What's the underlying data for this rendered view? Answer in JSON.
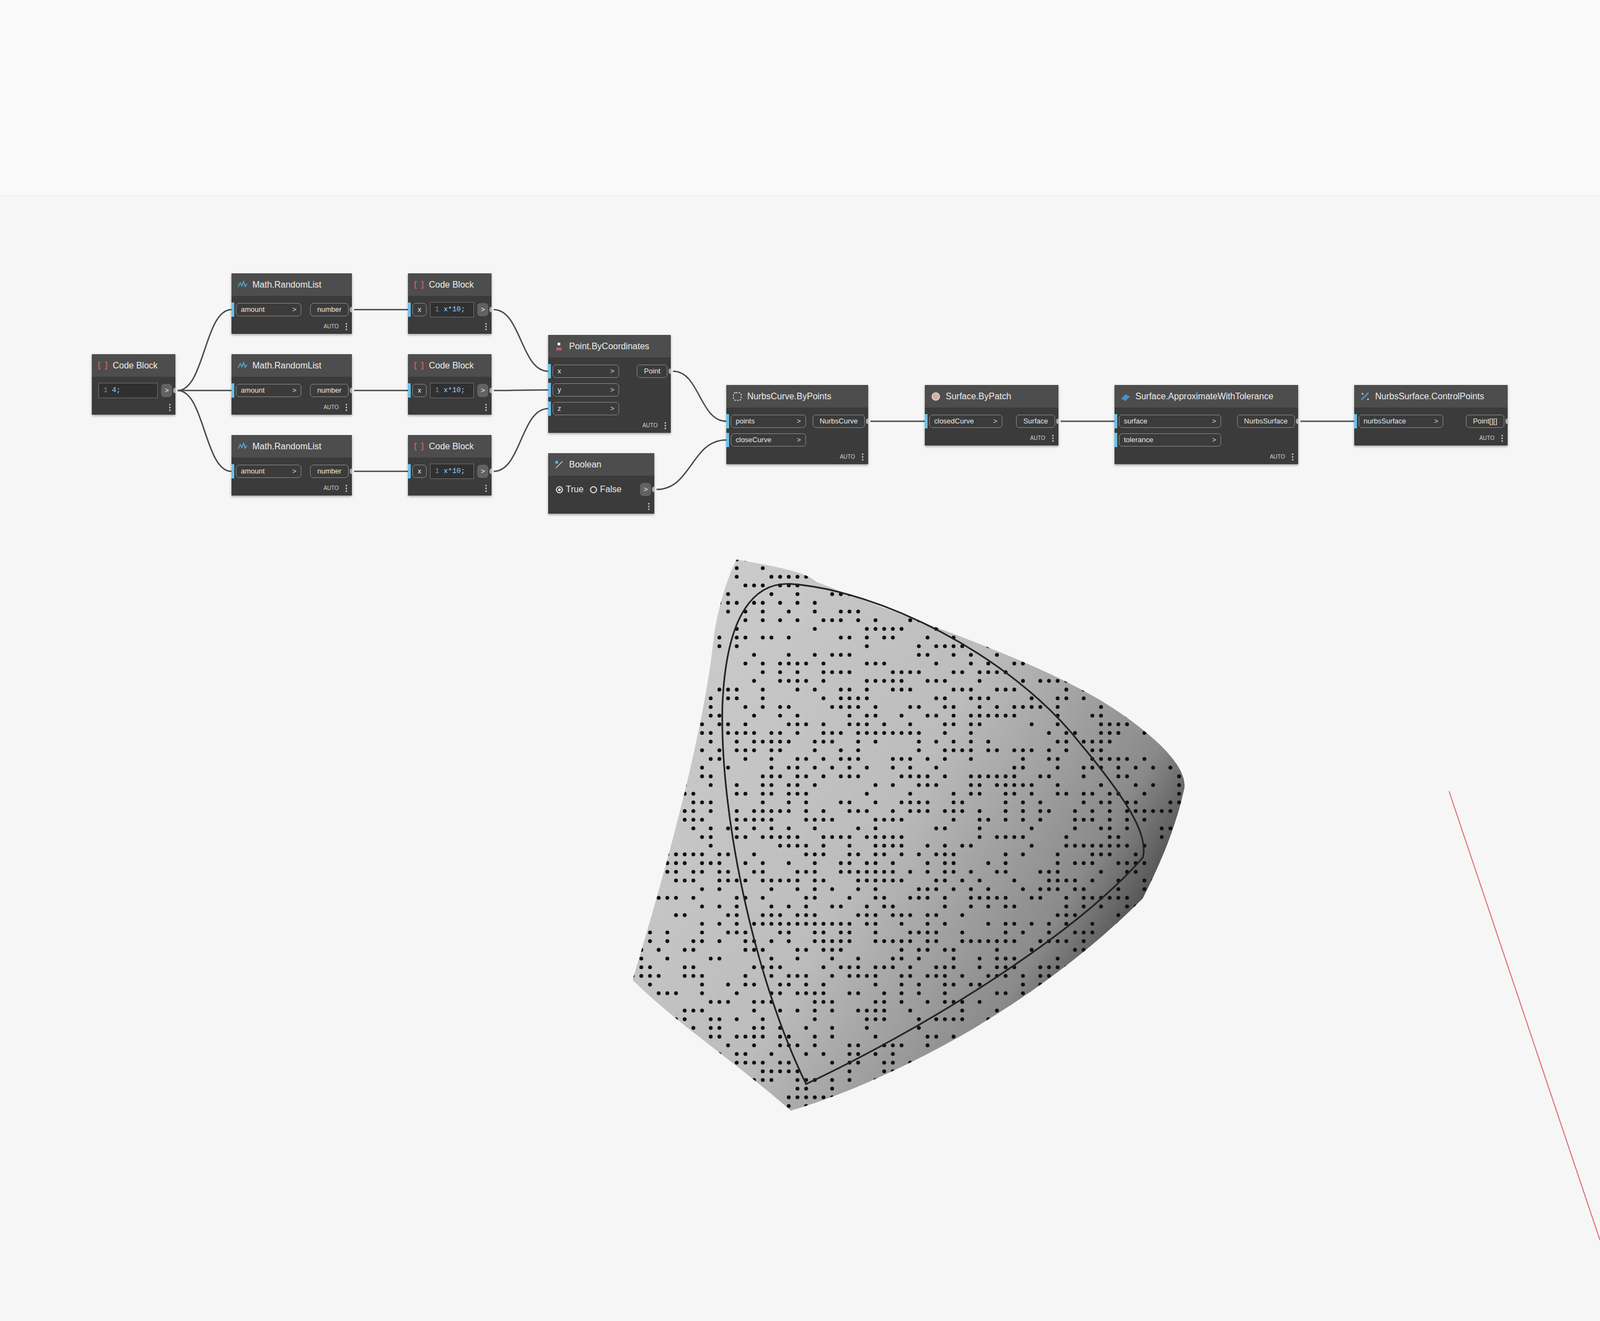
{
  "port_arrow": ">",
  "nodes": [
    {
      "title": "Code Block",
      "kind": "code",
      "inputs": [],
      "outputs": [
        ">"
      ],
      "line": "1",
      "code": "4;",
      "footer": ""
    },
    {
      "title": "Math.RandomList",
      "kind": "random",
      "inputs": [
        "amount"
      ],
      "outputs": [
        "number"
      ],
      "footer": "AUTO"
    },
    {
      "title": "Math.RandomList",
      "kind": "random",
      "inputs": [
        "amount"
      ],
      "outputs": [
        "number"
      ],
      "footer": "AUTO"
    },
    {
      "title": "Math.RandomList",
      "kind": "random",
      "inputs": [
        "amount"
      ],
      "outputs": [
        "number"
      ],
      "footer": "AUTO"
    },
    {
      "title": "Code Block",
      "kind": "code",
      "inputs": [
        "x"
      ],
      "outputs": [
        ">"
      ],
      "line": "1",
      "code": "x*10;",
      "footer": ""
    },
    {
      "title": "Code Block",
      "kind": "code",
      "inputs": [
        "x"
      ],
      "outputs": [
        ">"
      ],
      "line": "1",
      "code": "x*10;",
      "footer": ""
    },
    {
      "title": "Code Block",
      "kind": "code",
      "inputs": [
        "x"
      ],
      "outputs": [
        ">"
      ],
      "line": "1",
      "code": "x*10;",
      "footer": ""
    },
    {
      "title": "Point.ByCoordinates",
      "kind": "point",
      "inputs": [
        "x",
        "y",
        "z"
      ],
      "outputs": [
        "Point"
      ],
      "footer": "AUTO"
    },
    {
      "title": "Boolean",
      "kind": "boolean",
      "inputs": [],
      "outputs": [
        ">"
      ],
      "options": [
        {
          "label": "True",
          "selected": true
        },
        {
          "label": "False",
          "selected": false
        }
      ],
      "footer": ""
    },
    {
      "title": "NurbsCurve.ByPoints",
      "kind": "curve",
      "inputs": [
        "points",
        "closeCurve"
      ],
      "outputs": [
        "NurbsCurve"
      ],
      "footer": "AUTO"
    },
    {
      "title": "Surface.ByPatch",
      "kind": "patch",
      "inputs": [
        "closedCurve"
      ],
      "outputs": [
        "Surface"
      ],
      "footer": "AUTO"
    },
    {
      "title": "Surface.ApproximateWithTolerance",
      "kind": "approx",
      "inputs": [
        "surface",
        "tolerance"
      ],
      "outputs": [
        "NurbsSurface"
      ],
      "footer": "AUTO"
    },
    {
      "title": "NurbsSurface.ControlPoints",
      "kind": "controlpoints",
      "inputs": [
        "nurbsSurface"
      ],
      "outputs": [
        "Point[][]"
      ],
      "footer": "AUTO"
    }
  ],
  "wires": [
    {
      "from": 0,
      "fromPort": 0,
      "to": 1,
      "toPort": 0
    },
    {
      "from": 0,
      "fromPort": 0,
      "to": 2,
      "toPort": 0
    },
    {
      "from": 0,
      "fromPort": 0,
      "to": 3,
      "toPort": 0
    },
    {
      "from": 1,
      "fromPort": 0,
      "to": 4,
      "toPort": 0
    },
    {
      "from": 2,
      "fromPort": 0,
      "to": 5,
      "toPort": 0
    },
    {
      "from": 3,
      "fromPort": 0,
      "to": 6,
      "toPort": 0
    },
    {
      "from": 4,
      "fromPort": 0,
      "to": 7,
      "toPort": 0
    },
    {
      "from": 5,
      "fromPort": 0,
      "to": 7,
      "toPort": 1
    },
    {
      "from": 6,
      "fromPort": 0,
      "to": 7,
      "toPort": 2
    },
    {
      "from": 7,
      "fromPort": 0,
      "to": 9,
      "toPort": 0
    },
    {
      "from": 8,
      "fromPort": 0,
      "to": 9,
      "toPort": 1
    },
    {
      "from": 9,
      "fromPort": 0,
      "to": 10,
      "toPort": 0
    },
    {
      "from": 10,
      "fromPort": 0,
      "to": 11,
      "toPort": 0
    },
    {
      "from": 11,
      "fromPort": 0,
      "to": 12,
      "toPort": 0
    }
  ]
}
